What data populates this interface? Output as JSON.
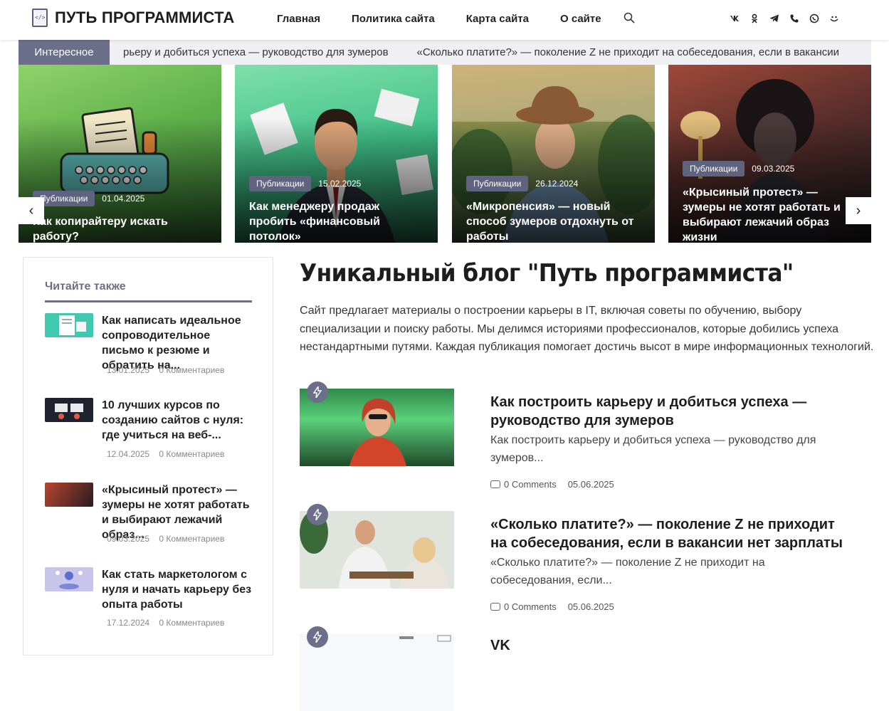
{
  "header": {
    "logo_text": "ПУТЬ ПРОГРАММИСТА",
    "nav": [
      "Главная",
      "Политика сайта",
      "Карта сайта",
      "О сайте"
    ],
    "socials": [
      "vk-icon",
      "ok-icon",
      "telegram-icon",
      "viber-icon",
      "whatsapp-icon",
      "vk-messenger-icon"
    ]
  },
  "ticker": {
    "label": "Интересное",
    "items": [
      "рьеру и добиться успеха — руководство для зумеров",
      "«Сколько платите?» — поколение Z не приходит на собеседования, если в вакансии"
    ]
  },
  "slider": {
    "prev": "‹",
    "next": "›",
    "slides": [
      {
        "category": "Публикации",
        "date": "01.04.2025",
        "title": "Как копирайтеру искать работу?"
      },
      {
        "category": "Публикации",
        "date": "15.02.2025",
        "title": "Как менеджеру продаж пробить «финансовый потолок»"
      },
      {
        "category": "Публикации",
        "date": "26.12.2024",
        "title": "«Микропенсия» — новый способ зумеров отдохнуть от работы"
      },
      {
        "category": "Публикации",
        "date": "09.03.2025",
        "title": "«Крысиный протест» — зумеры не хотят работать и выбирают лежачий образ жизни"
      }
    ]
  },
  "sidebar": {
    "title": "Читайте также",
    "items": [
      {
        "title": "Как написать идеальное сопроводительное письмо к резюме и обратить на...",
        "date": "13.01.2025",
        "comments": "0 Комментариев"
      },
      {
        "title": "10 лучших курсов по созданию сайтов с нуля: где учиться на веб-...",
        "date": "12.04.2025",
        "comments": "0 Комментариев"
      },
      {
        "title": "«Крысиный протест» — зумеры не хотят работать и выбирают лежачий образ...",
        "date": "09.03.2025",
        "comments": "0 Комментариев"
      },
      {
        "title": "Как стать маркетологом с нуля и начать карьеру без опыта работы",
        "date": "17.12.2024",
        "comments": "0 Комментариев"
      }
    ]
  },
  "main": {
    "title": "Уникальный блог \"Путь программиста\"",
    "description": "Сайт предлагает материалы о построении карьеры в IT, включая советы по обучению, выбору специализации и поиску работы. Мы делимся историями профессионалов, которые добились успеха нестандартными путями. Каждая публикация помогает достичь высот в мире информационных технологий.",
    "posts": [
      {
        "title": "Как построить карьеру и добиться успеха — руководство для зумеров",
        "excerpt": "Как построить карьеру и добиться успеха — руководство для зумеров...",
        "comments": "0 Comments",
        "date": "05.06.2025"
      },
      {
        "title": "«Сколько платите?» — поколение Z не приходит на собеседования, если в вакансии нет зарплаты",
        "excerpt": "«Сколько платите?» — поколение Z не приходит на собеседования, если...",
        "comments": "0 Comments",
        "date": "05.06.2025"
      },
      {
        "title": "VK",
        "excerpt": "",
        "comments": "",
        "date": ""
      }
    ]
  },
  "colors": {
    "accent": "#6b6f8a",
    "badge": "#5f6380"
  }
}
